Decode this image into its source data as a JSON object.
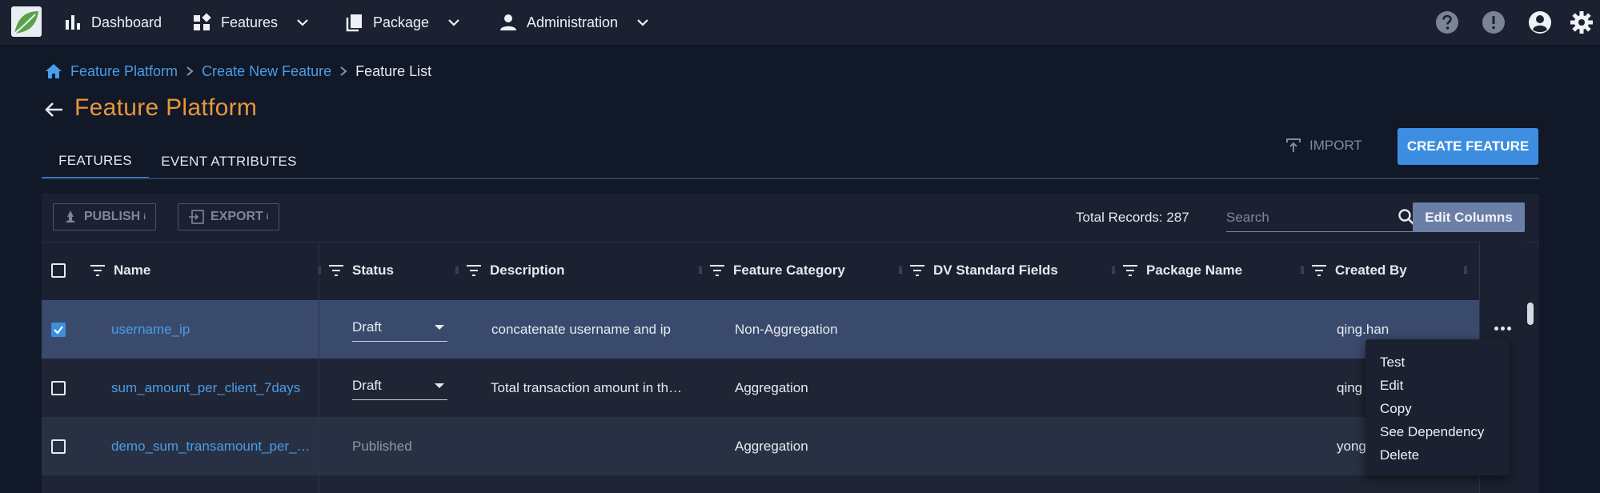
{
  "nav": {
    "items": [
      {
        "label": "Dashboard",
        "icon": "bar-chart-icon"
      },
      {
        "label": "Features",
        "icon": "widgets-icon"
      },
      {
        "label": "Package",
        "icon": "copy-icon"
      },
      {
        "label": "Administration",
        "icon": "person-icon"
      }
    ],
    "right_icons": [
      "help-icon",
      "info-alert-icon",
      "account-icon",
      "settings-icon"
    ]
  },
  "breadcrumb": {
    "items": [
      "Feature Platform",
      "Create New Feature",
      "Feature List"
    ]
  },
  "page": {
    "title": "Feature Platform"
  },
  "tabs": [
    {
      "label": "FEATURES",
      "active": true
    },
    {
      "label": "EVENT ATTRIBUTES",
      "active": false
    }
  ],
  "actions": {
    "import_label": "IMPORT",
    "create_label": "CREATE FEATURE"
  },
  "toolbar": {
    "publish_label": "PUBLISH",
    "export_label": "EXPORT",
    "info_glyph": "i",
    "total_records": "Total Records: 287",
    "search_placeholder": "Search",
    "edit_columns_label": "Edit Columns"
  },
  "table": {
    "columns": [
      "Name",
      "Status",
      "Description",
      "Feature Category",
      "DV Standard Fields",
      "Package Name",
      "Created By"
    ],
    "rows": [
      {
        "selected": true,
        "name": "username_ip",
        "status": "Draft",
        "description": "concatenate username and ip",
        "category": "Non-Aggregation",
        "created_by": "qing.han"
      },
      {
        "selected": false,
        "name": "sum_amount_per_client_7days",
        "status": "Draft",
        "description": "Total transaction amount in th…",
        "category": "Aggregation",
        "created_by": "qing"
      },
      {
        "selected": false,
        "name": "demo_sum_transamount_per_…",
        "status": "Published",
        "description": "",
        "category": "Aggregation",
        "created_by": "yong"
      }
    ]
  },
  "context_menu": {
    "items": [
      "Test",
      "Edit",
      "Copy",
      "See Dependency",
      "Delete"
    ]
  },
  "colors": {
    "accent": "#3d8ee0",
    "title": "#e8963c",
    "link": "#4a9de8",
    "background": "#111827",
    "panel": "#1b2130",
    "selected_row": "#3a4a6d"
  }
}
